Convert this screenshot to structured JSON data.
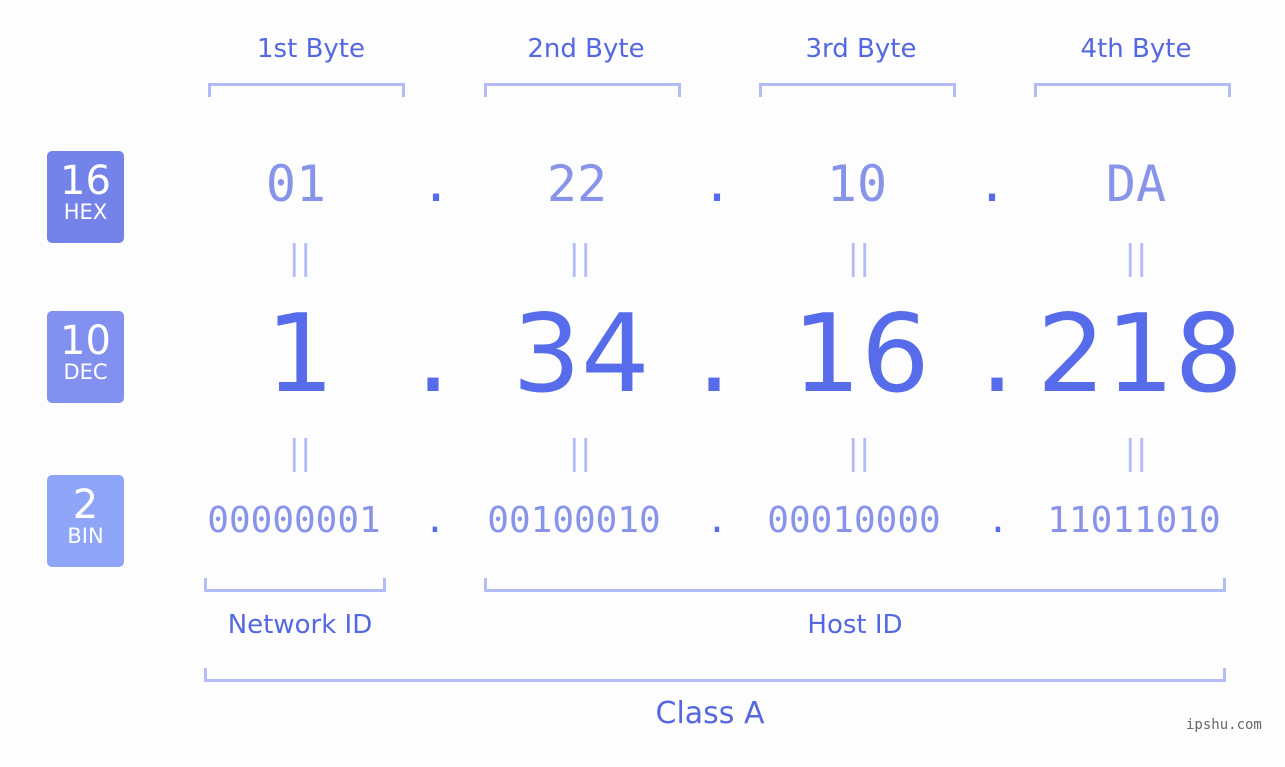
{
  "byte_headers": [
    "1st Byte",
    "2nd Byte",
    "3rd Byte",
    "4th Byte"
  ],
  "badges": {
    "hex": {
      "num": "16",
      "label": "HEX",
      "color": "#7383ea"
    },
    "dec": {
      "num": "10",
      "label": "DEC",
      "color": "#8290f0"
    },
    "bin": {
      "num": "2",
      "label": "BIN",
      "color": "#8fa5f8"
    }
  },
  "hex_values": [
    "01",
    "22",
    "10",
    "DA"
  ],
  "dec_values": [
    "1",
    "34",
    "16",
    "218"
  ],
  "bin_values": [
    "00000001",
    "00100010",
    "00010000",
    "11011010"
  ],
  "separator": ".",
  "equals": "||",
  "network_id_label": "Network ID",
  "host_id_label": "Host ID",
  "class_label": "Class A",
  "watermark": "ipshu.com"
}
